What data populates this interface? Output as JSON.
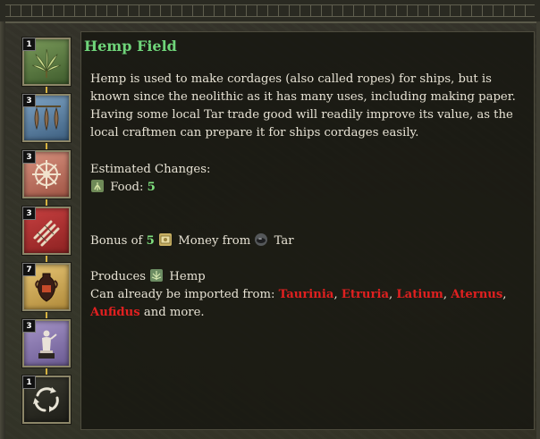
{
  "tooltip": {
    "title": "Hemp Field",
    "description": "Hemp is used to make cordages (also called ropes) for ships, but is known since the neolithic as it has many uses, including making paper. Having some local Tar trade good will readily improve its value, as the local craftmen can prepare it for ships cordages easily.",
    "estimated_changes_label": "Estimated Changes:",
    "food_label": "Food:",
    "food_value": "5",
    "bonus_prefix": "Bonus of",
    "bonus_value": "5",
    "bonus_money_label": "Money from",
    "bonus_source": "Tar",
    "produces_label": "Produces",
    "produces_item": "Hemp",
    "import_label": "Can already be imported from:",
    "import_sources": [
      "Taurinia",
      "Etruria",
      "Latium",
      "Aternus",
      "Aufidus"
    ],
    "import_suffix": "and more.",
    "separator": ", "
  },
  "chain": [
    {
      "count": "1",
      "icon": "hemp-leaf-icon"
    },
    {
      "count": "3",
      "icon": "hanging-fish-icon"
    },
    {
      "count": "3",
      "icon": "ship-wheel-icon"
    },
    {
      "count": "3",
      "icon": "rope-bundle-icon"
    },
    {
      "count": "7",
      "icon": "amphora-icon"
    },
    {
      "count": "3",
      "icon": "statue-icon"
    },
    {
      "count": "1",
      "icon": "cycle-arrows-icon"
    }
  ],
  "colors": {
    "title": "#6fd57a",
    "highlight_value": "#7fe07f",
    "import_source": "#e02020",
    "chain_line": "#d6b240"
  }
}
